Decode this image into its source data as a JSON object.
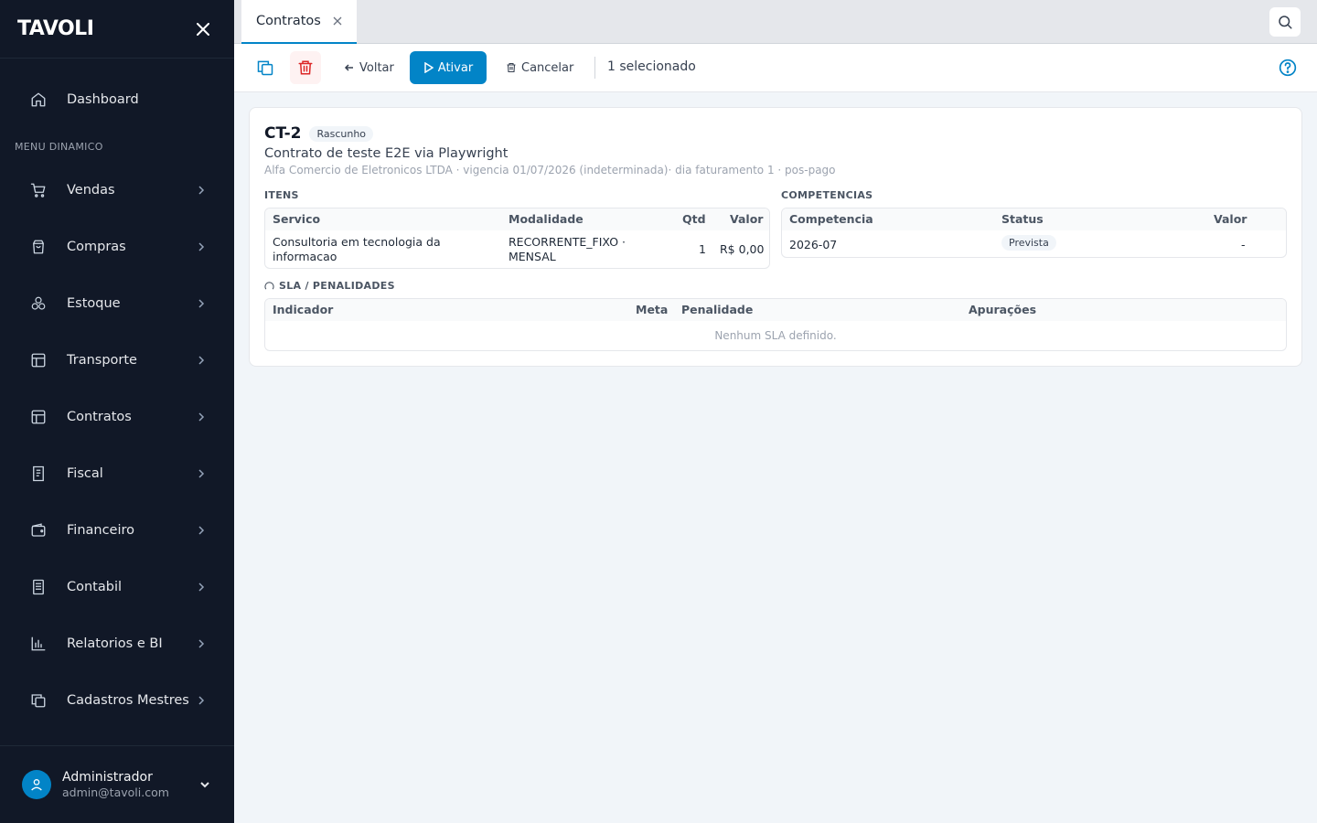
{
  "app": {
    "brand": "TAVOLI"
  },
  "sidebar": {
    "dashboard": {
      "label": "Dashboard"
    },
    "section_title": "MENU DINAMICO",
    "items": [
      {
        "label": "Vendas",
        "icon": "cart-icon"
      },
      {
        "label": "Compras",
        "icon": "bag-icon"
      },
      {
        "label": "Estoque",
        "icon": "boxes-icon"
      },
      {
        "label": "Transporte",
        "icon": "layout-icon"
      },
      {
        "label": "Contratos",
        "icon": "layout-icon"
      },
      {
        "label": "Fiscal",
        "icon": "receipt-icon"
      },
      {
        "label": "Financeiro",
        "icon": "wallet-icon"
      },
      {
        "label": "Contabil",
        "icon": "ledger-icon"
      },
      {
        "label": "Relatorios e BI",
        "icon": "bar-chart-icon"
      },
      {
        "label": "Cadastros Mestres",
        "icon": "copy-icon"
      }
    ],
    "user": {
      "name": "Administrador",
      "email": "admin@tavoli.com"
    }
  },
  "tabs": [
    {
      "label": "Contratos",
      "active": true
    }
  ],
  "toolbar": {
    "back_label": "Voltar",
    "activate_label": "Ativar",
    "cancel_label": "Cancelar",
    "selected_text": "1 selecionado"
  },
  "contract": {
    "code": "CT-2",
    "status": "Rascunho",
    "description": "Contrato de teste E2E via Playwright",
    "meta": "Alfa Comercio de Eletronicos LTDA · vigencia 01/07/2026 (indeterminada)· dia faturamento 1 · pos-pago"
  },
  "items_section": {
    "title": "ITENS",
    "columns": {
      "service": "Servico",
      "modality": "Modalidade",
      "qty": "Qtd",
      "value": "Valor"
    },
    "rows": [
      {
        "service_line1": "Consultoria em tecnologia da",
        "service_line2": "informacao",
        "modality_line1": "RECORRENTE_FIXO ·",
        "modality_line2": "MENSAL",
        "qty": "1",
        "value": "R$ 0,00"
      }
    ]
  },
  "competencias_section": {
    "title": "COMPETENCIAS",
    "columns": {
      "competencia": "Competencia",
      "status": "Status",
      "value": "Valor"
    },
    "rows": [
      {
        "competencia": "2026-07",
        "status": "Prevista",
        "value": "-"
      }
    ]
  },
  "sla_section": {
    "title": "SLA / PENALIDADES",
    "columns": {
      "indicator": "Indicador",
      "goal": "Meta",
      "penalty": "Penalidade",
      "measurements": "Apurações"
    },
    "empty_text": "Nenhum SLA definido."
  },
  "colors": {
    "sidebar_bg": "#111827",
    "accent": "#0284c7",
    "danger": "#dc2626"
  }
}
